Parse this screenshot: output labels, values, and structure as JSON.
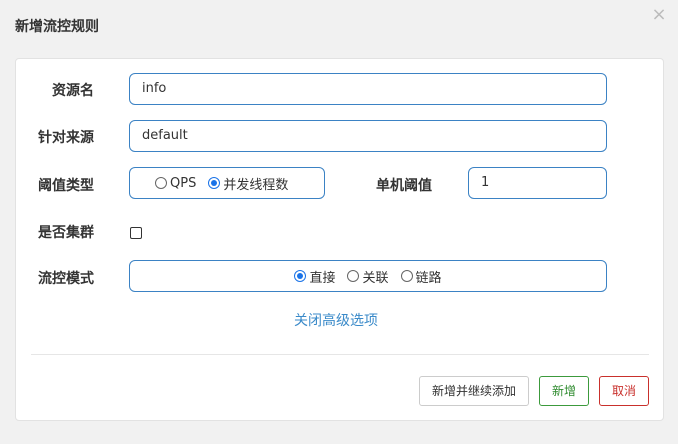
{
  "dialog": {
    "title": "新增流控规则",
    "close_symbol": "×"
  },
  "form": {
    "resource": {
      "label": "资源名",
      "value": "info"
    },
    "source": {
      "label": "针对来源",
      "value": "default"
    },
    "threshold_type": {
      "label": "阈值类型",
      "options": [
        {
          "label": "QPS",
          "checked": false
        },
        {
          "label": "并发线程数",
          "checked": true
        }
      ]
    },
    "single_threshold": {
      "label": "单机阈值",
      "value": "1"
    },
    "cluster": {
      "label": "是否集群",
      "checked": false
    },
    "flow_mode": {
      "label": "流控模式",
      "options": [
        {
          "label": "直接",
          "checked": true
        },
        {
          "label": "关联",
          "checked": false
        },
        {
          "label": "链路",
          "checked": false
        }
      ]
    },
    "advanced_link": "关闭高级选项"
  },
  "footer": {
    "add_continue_label": "新增并继续添加",
    "add_label": "新增",
    "cancel_label": "取消"
  },
  "colors": {
    "input_border": "#3b82c4",
    "radio_checked": "#1a73e8",
    "link": "#3a8ac9",
    "success": "#2e8b2e",
    "danger": "#c9302c"
  }
}
